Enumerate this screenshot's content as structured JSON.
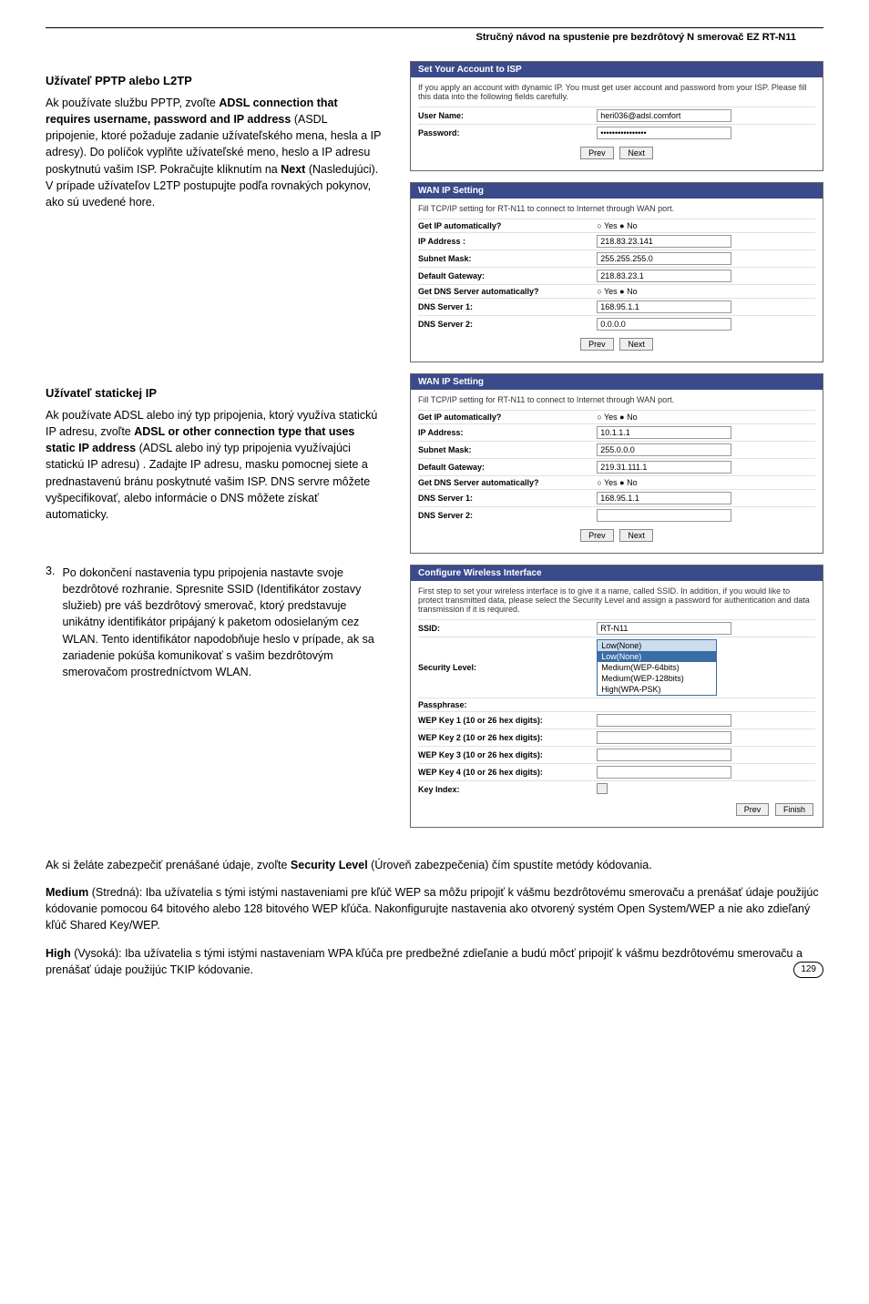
{
  "header": {
    "title": "Stručný návod na spustenie pre bezdrôtový N smerovač EZ RT-N11"
  },
  "section_pptp": {
    "heading": "Užívateľ PPTP alebo L2TP",
    "p1a": "Ak používate službu PPTP, zvoľte ",
    "p1b": "ADSL connection that requires username, password and IP address",
    "p1c": " (ASDL pripojenie, ktoré požaduje zadanie užívateľského mena, hesla a IP adresy). Do políčok vyplňte užívateľské meno, heslo a IP adresu poskytnutú vašim ISP. Pokračujte kliknutím na ",
    "p1d": "Next",
    "p1e": " (Nasledujúci). V prípade užívateľov L2TP postupujte podľa rovnakých pokynov, ako sú uvedené hore."
  },
  "panel_isp": {
    "title": "Set Your Account to ISP",
    "desc": "If you apply an account with dynamic IP. You must get user account and password from your ISP. Please fill this data into the following fields carefully.",
    "username_label": "User Name:",
    "username_value": "heri036@adsl.comfort",
    "password_label": "Password:",
    "password_value": "••••••••••••••••",
    "prev": "Prev",
    "next": "Next"
  },
  "panel_wan1": {
    "title": "WAN IP Setting",
    "desc": "Fill TCP/IP setting for RT-N11 to connect to Internet through WAN port.",
    "rows": {
      "r1l": "Get IP automatically?",
      "r1v": "○ Yes  ● No",
      "r2l": "IP Address :",
      "r2v": "218.83.23.141",
      "r3l": "Subnet Mask:",
      "r3v": "255.255.255.0",
      "r4l": "Default Gateway:",
      "r4v": "218.83.23.1",
      "r5l": "Get DNS Server automatically?",
      "r5v": "○ Yes  ● No",
      "r6l": "DNS Server 1:",
      "r6v": "168.95.1.1",
      "r7l": "DNS Server 2:",
      "r7v": "0.0.0.0"
    },
    "prev": "Prev",
    "next": "Next"
  },
  "section_static": {
    "heading": "Užívateľ statickej IP",
    "p1a": "Ak používate ADSL alebo iný typ pripojenia, ktorý využíva statickú IP adresu, zvoľte ",
    "p1b": "ADSL or other connection type that uses static IP address",
    "p1c": " (ADSL alebo iný typ pripojenia využívajúci statickú IP adresu) . Zadajte IP adresu, masku pomocnej siete a prednastavenú bránu poskytnuté vašim ISP. DNS servre môžete vyšpecifikovať, alebo informácie o DNS môžete získať automaticky."
  },
  "panel_wan2": {
    "title": "WAN IP Setting",
    "desc": "Fill TCP/IP setting for RT-N11 to connect to Internet through WAN port.",
    "rows": {
      "r1l": "Get IP automatically?",
      "r1v": "○ Yes ● No",
      "r2l": "IP Address:",
      "r2v": "10.1.1.1",
      "r3l": "Subnet Mask:",
      "r3v": "255.0.0.0",
      "r4l": "Default Gateway:",
      "r4v": "219.31.111.1",
      "r5l": "Get DNS Server automatically?",
      "r5v": "○ Yes ● No",
      "r6l": "DNS Server 1:",
      "r6v": "168.95.1.1",
      "r7l": "DNS Server 2:",
      "r7v": ""
    },
    "prev": "Prev",
    "next": "Next"
  },
  "step3": {
    "text": "Po dokončení nastavenia typu pripojenia nastavte svoje bezdrôtové rozhranie. Spresnite SSID (Identifikátor zostavy služieb) pre váš bezdrôtový smerovač, ktorý predstavuje unikátny identifikátor pripájaný k paketom odosielaným cez WLAN. Tento identifikátor napodobňuje heslo v prípade, ak sa zariadenie pokúša komunikovať s vašim bezdrôtovým smerovačom prostredníctvom WLAN.",
    "num": "3."
  },
  "panel_wifi": {
    "title": "Configure Wireless Interface",
    "desc": "First step to set your wireless interface is to give it a name, called SSID. In addition, if you would like to protect transmitted data, please select the Security Level and assign a password for authentication and data transmission if it is required.",
    "rows": {
      "r1l": "SSID:",
      "r1v": "RT-N11",
      "r2l": "Security Level:",
      "dd_sel": "Low(None)",
      "dd_o1": "Low(None)",
      "dd_o2": "Medium(WEP-64bits)",
      "dd_o3": "Medium(WEP-128bits)",
      "dd_o4": "High(WPA-PSK)",
      "r3l": "Passphrase:",
      "r4l": "WEP Key 1 (10 or 26 hex digits):",
      "r5l": "WEP Key 2 (10 or 26 hex digits):",
      "r6l": "WEP Key 3 (10 or 26 hex digits):",
      "r7l": "WEP Key 4 (10 or 26 hex digits):",
      "r8l": "Key Index:"
    },
    "prev": "Prev",
    "finish": "Finish"
  },
  "bottom": {
    "p1a": "Ak si želáte zabezpečiť prenášané údaje, zvoľte ",
    "p1b": "Security Level",
    "p1c": " (Úroveň zabezpečenia) čím spustíte metódy kódovania.",
    "p2a": "Medium",
    "p2b": " (Stredná): Iba užívatelia s tými istými nastaveniami pre kľúč WEP sa môžu pripojiť k vášmu bezdrôtovému smerovaču a prenášať údaje použijúc kódovanie pomocou 64 bitového alebo 128 bitového WEP kľúča. Nakonfigurujte nastavenia ako otvorený systém Open System/WEP a nie ako zdieľaný kľúč Shared Key/WEP.",
    "p3a": "High",
    "p3b": " (Vysoká): Iba užívatelia s tými istými nastaveniam WPA kľúča pre predbežné zdieľanie a budú môcť pripojiť k vášmu bezdrôtovému smerovaču a prenášať údaje použijúc TKIP kódovanie."
  },
  "page": "129"
}
